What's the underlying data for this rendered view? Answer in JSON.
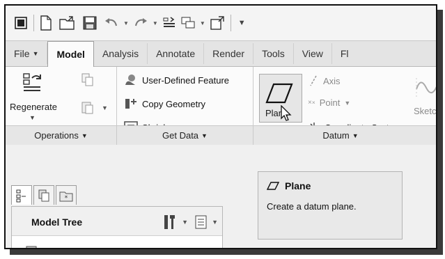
{
  "quick_access": {
    "icons": [
      "window-icon",
      "new-file-icon",
      "open-folder-icon",
      "save-icon",
      "undo-icon",
      "redo-icon",
      "regenerate-small-icon",
      "windows-icon",
      "close-window-icon",
      "customize-icon"
    ]
  },
  "tabs": [
    {
      "label": "File",
      "dropdown": true,
      "active": false
    },
    {
      "label": "Model",
      "active": true
    },
    {
      "label": "Analysis",
      "active": false
    },
    {
      "label": "Annotate",
      "active": false
    },
    {
      "label": "Render",
      "active": false
    },
    {
      "label": "Tools",
      "active": false
    },
    {
      "label": "View",
      "active": false
    },
    {
      "label": "Fl",
      "active": false
    }
  ],
  "ribbon": {
    "operations": {
      "regenerate_label": "Regenerate",
      "footer": "Operations"
    },
    "get_data": {
      "items": [
        "User-Defined Feature",
        "Copy Geometry",
        "Shrinkwrap"
      ],
      "footer": "Get Data"
    },
    "datum": {
      "plane_label": "Plane",
      "axis_label": "Axis",
      "point_label": "Point",
      "csys_label": "Coordinate System",
      "sketch_label": "Sketc",
      "footer": "Datum"
    }
  },
  "tooltip": {
    "title": "Plane",
    "description": "Create a datum plane."
  },
  "model_tree": {
    "title": "Model Tree"
  },
  "colors": {
    "tab_bar": "#e4e4e4",
    "ribbon": "#fbfbfb",
    "footer": "#e6e6e6",
    "tooltip": "#e9e9e9"
  }
}
